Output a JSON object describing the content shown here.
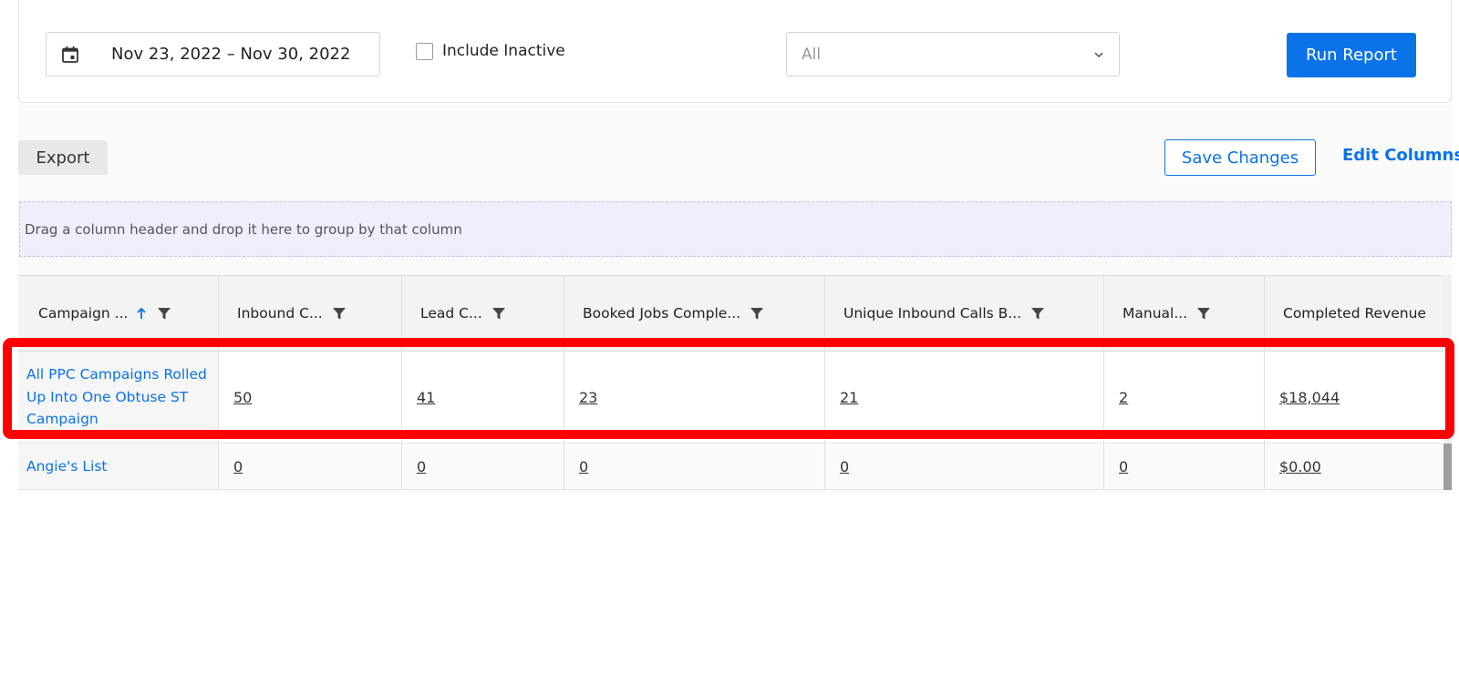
{
  "filters": {
    "date_range": "Nov 23, 2022 – Nov 30, 2022",
    "include_inactive_label": "Include Inactive",
    "include_inactive_checked": false,
    "select_value": "All",
    "run_report_label": "Run Report"
  },
  "toolbar": {
    "export_label": "Export",
    "save_changes_label": "Save Changes",
    "edit_columns_label": "Edit Columns"
  },
  "group_panel": {
    "hint": "Drag a column header and drop it here to group by that column"
  },
  "table": {
    "columns": [
      {
        "label": "Campaign ...",
        "sorted": "ascending"
      },
      {
        "label": "Inbound C..."
      },
      {
        "label": "Lead C..."
      },
      {
        "label": "Booked Jobs Comple..."
      },
      {
        "label": "Unique Inbound Calls B..."
      },
      {
        "label": "Manual..."
      },
      {
        "label": "Completed Revenue"
      }
    ],
    "rows": [
      {
        "campaign": "All PPC Campaigns Rolled Up Into One Obtuse ST Campaign",
        "inbound": "50",
        "lead": "41",
        "booked": "23",
        "unique": "21",
        "manual": "2",
        "revenue": "$18,044"
      },
      {
        "campaign": "Angie's List",
        "inbound": "0",
        "lead": "0",
        "booked": "0",
        "unique": "0",
        "manual": "0",
        "revenue": "$0.00"
      }
    ]
  },
  "colors": {
    "accent": "#0b73e8",
    "highlight": "#ff0000",
    "group_panel_bg": "#f1edfc"
  }
}
